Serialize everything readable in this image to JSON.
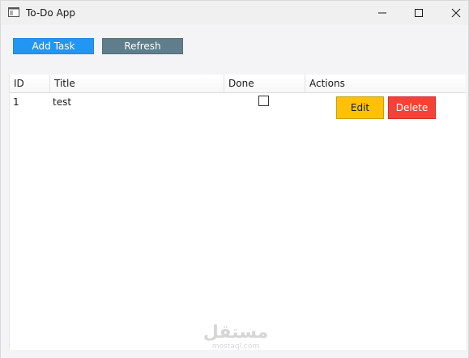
{
  "window": {
    "title": "To-Do App"
  },
  "toolbar": {
    "add_label": "Add Task",
    "refresh_label": "Refresh"
  },
  "table": {
    "columns": [
      "ID",
      "Title",
      "Done",
      "Actions"
    ],
    "rows": [
      {
        "id": "1",
        "title": "test",
        "done": false,
        "edit_label": "Edit",
        "delete_label": "Delete"
      }
    ]
  },
  "watermark": {
    "main": "مستقل",
    "sub": "mostaql.com"
  },
  "colors": {
    "add_button": "#2196f3",
    "refresh_button": "#607d8b",
    "edit_button": "#ffc107",
    "delete_button": "#f44336"
  },
  "icons": {
    "app": "app-window-icon",
    "minimize": "minimize-icon",
    "maximize": "maximize-icon",
    "close": "close-icon"
  }
}
